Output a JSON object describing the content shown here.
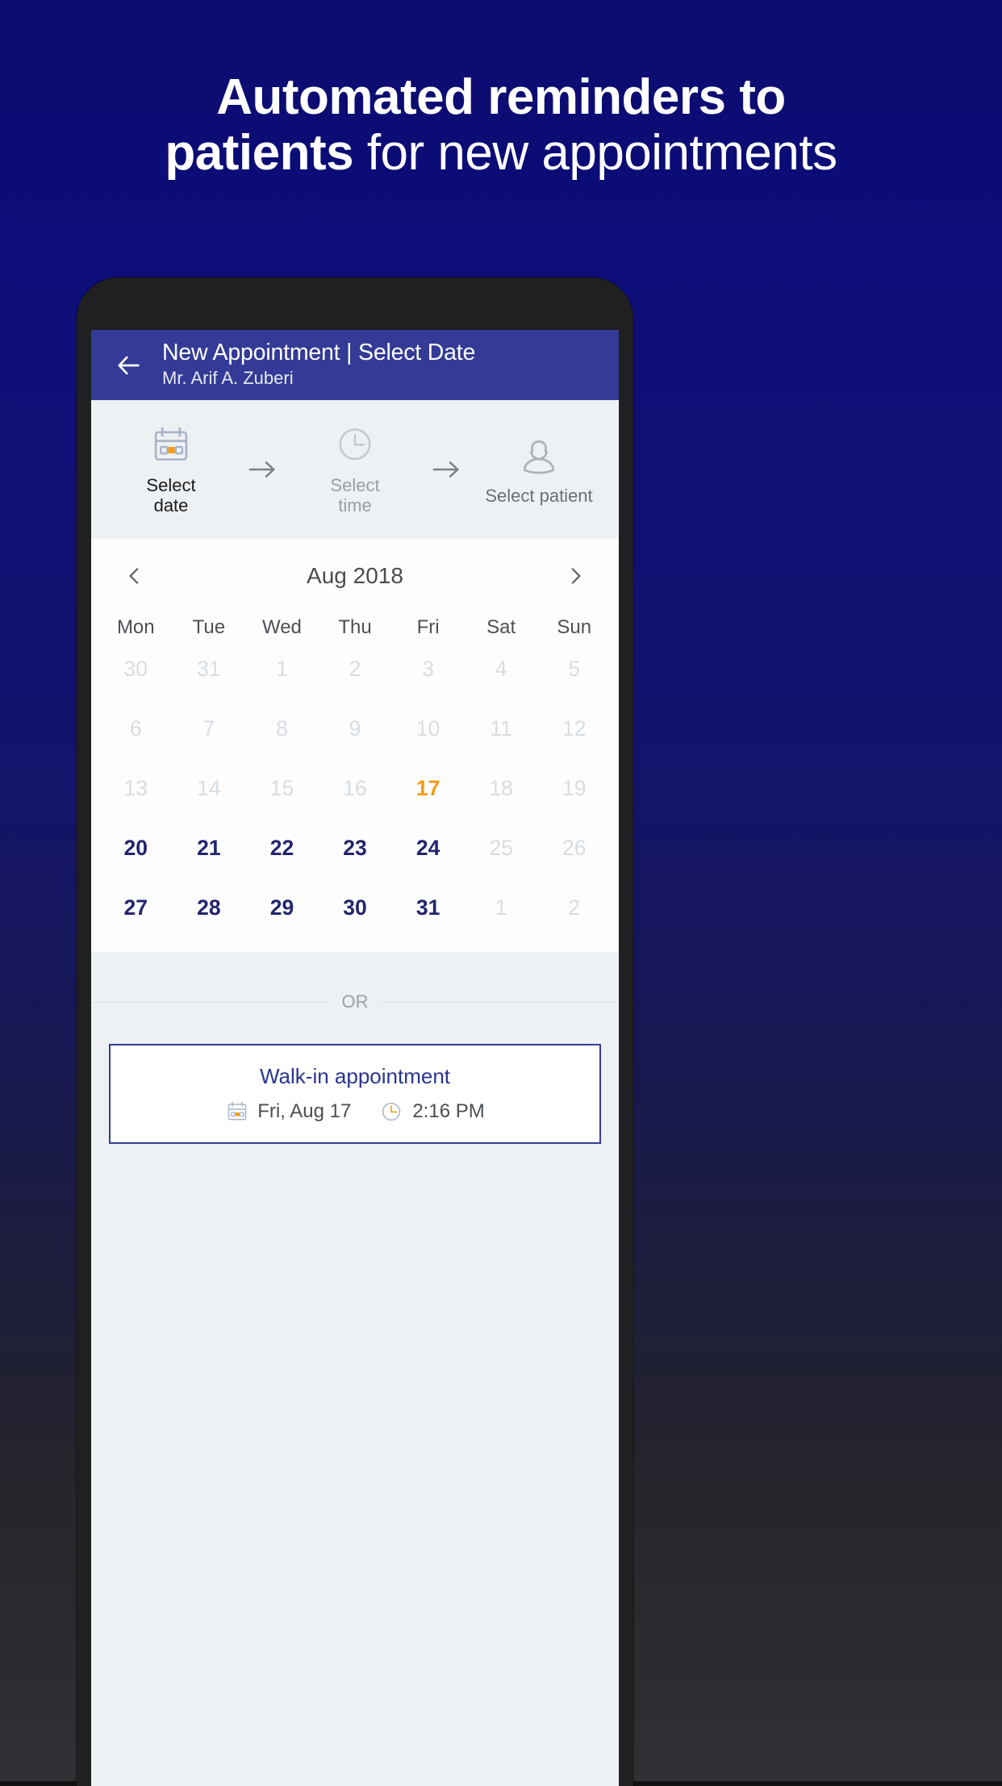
{
  "promo": {
    "headline_line1_bold": "Automated reminders to",
    "headline_line2_bold": "patients",
    "headline_line2_regular": " for new appointments",
    "background_top_color": "#0b0b6e",
    "background_bottom_color": "#313135"
  },
  "appbar": {
    "back_icon": "back-arrow-icon",
    "title": "New Appointment | Select Date",
    "subtitle": "Mr. Arif A. Zuberi",
    "background_color": "#333b96",
    "text_color": "#ffffff"
  },
  "stepper": {
    "separator_icon": "arrow-right-icon",
    "steps": [
      {
        "icon": "calendar-icon",
        "label": "Select\ndate",
        "label_line1": "Select",
        "label_line2": "date",
        "state": "active"
      },
      {
        "icon": "clock-icon",
        "label": "Select\ntime",
        "label_line1": "Select",
        "label_line2": "time",
        "state": "inactive"
      },
      {
        "icon": "person-icon",
        "label": "Select patient",
        "state": "inactive"
      }
    ]
  },
  "calendar": {
    "prev_icon": "chevron-left-icon",
    "next_icon": "chevron-right-icon",
    "month_label": "Aug 2018",
    "weekday_headers": [
      "Mon",
      "Tue",
      "Wed",
      "Thu",
      "Fri",
      "Sat",
      "Sun"
    ],
    "today_color": "#f59a14",
    "selectable_color": "#24246e",
    "disabled_color": "#d8dde2",
    "weeks": [
      [
        {
          "n": "30",
          "state": "disabled"
        },
        {
          "n": "31",
          "state": "disabled"
        },
        {
          "n": "1",
          "state": "disabled"
        },
        {
          "n": "2",
          "state": "disabled"
        },
        {
          "n": "3",
          "state": "disabled"
        },
        {
          "n": "4",
          "state": "disabled"
        },
        {
          "n": "5",
          "state": "disabled"
        }
      ],
      [
        {
          "n": "6",
          "state": "disabled"
        },
        {
          "n": "7",
          "state": "disabled"
        },
        {
          "n": "8",
          "state": "disabled"
        },
        {
          "n": "9",
          "state": "disabled"
        },
        {
          "n": "10",
          "state": "disabled"
        },
        {
          "n": "11",
          "state": "disabled"
        },
        {
          "n": "12",
          "state": "disabled"
        }
      ],
      [
        {
          "n": "13",
          "state": "disabled"
        },
        {
          "n": "14",
          "state": "disabled"
        },
        {
          "n": "15",
          "state": "disabled"
        },
        {
          "n": "16",
          "state": "disabled"
        },
        {
          "n": "17",
          "state": "today"
        },
        {
          "n": "18",
          "state": "disabled"
        },
        {
          "n": "19",
          "state": "disabled"
        }
      ],
      [
        {
          "n": "20",
          "state": "selectable"
        },
        {
          "n": "21",
          "state": "selectable"
        },
        {
          "n": "22",
          "state": "selectable"
        },
        {
          "n": "23",
          "state": "selectable"
        },
        {
          "n": "24",
          "state": "selectable"
        },
        {
          "n": "25",
          "state": "disabled"
        },
        {
          "n": "26",
          "state": "disabled"
        }
      ],
      [
        {
          "n": "27",
          "state": "selectable"
        },
        {
          "n": "28",
          "state": "selectable"
        },
        {
          "n": "29",
          "state": "selectable"
        },
        {
          "n": "30",
          "state": "selectable"
        },
        {
          "n": "31",
          "state": "selectable"
        },
        {
          "n": "1",
          "state": "disabled"
        },
        {
          "n": "2",
          "state": "disabled"
        }
      ]
    ]
  },
  "divider": {
    "label": "OR"
  },
  "walkin": {
    "title": "Walk-in appointment",
    "date_icon": "calendar-icon",
    "date": "Fri, Aug 17",
    "time_icon": "clock-icon",
    "time": "2:16 PM",
    "border_color": "#353d8f",
    "title_color": "#2b3490"
  }
}
